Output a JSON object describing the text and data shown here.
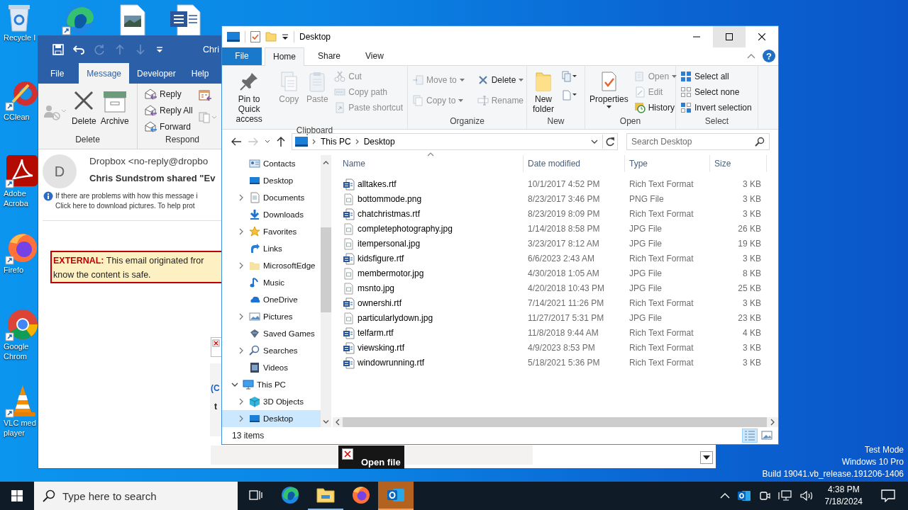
{
  "desktop": {
    "icons": [
      {
        "kind": "recycle",
        "label_lines": [
          "Recycle I"
        ]
      },
      {
        "kind": "ccleaner",
        "label_lines": [
          "CClean"
        ]
      },
      {
        "kind": "acrobat",
        "label_lines": [
          "Adobe",
          "Acroba"
        ]
      },
      {
        "kind": "firefox",
        "label_lines": [
          "Firefo"
        ]
      },
      {
        "kind": "chrome",
        "label_lines": [
          "Google",
          "Chrom"
        ]
      },
      {
        "kind": "vlc",
        "label_lines": [
          "VLC med",
          "player"
        ]
      }
    ],
    "top_icons": [
      {
        "kind": "edge"
      },
      {
        "kind": "image"
      },
      {
        "kind": "word"
      }
    ],
    "os_notice": [
      "Test Mode",
      "Windows 10 Pro",
      "Build 19041.vb_release.191206-1406"
    ]
  },
  "outlook": {
    "title": "Chri",
    "tabs": [
      {
        "label": "File",
        "selected": false
      },
      {
        "label": "Message",
        "selected": true
      },
      {
        "label": "Developer",
        "selected": false
      },
      {
        "label": "Help",
        "selected": false
      }
    ],
    "ribbon": {
      "delete_group": {
        "label": "Delete",
        "buttons": [
          "Delete",
          "Archive"
        ]
      },
      "respond_group": {
        "label": "Respond",
        "buttons": [
          "Reply",
          "Reply All",
          "Forward"
        ]
      }
    },
    "message": {
      "avatar": "D",
      "sender": "Dropbox <no-reply@dropbo",
      "subject": "Chris Sundstrom shared \"Ev",
      "info_lines": [
        "If there are problems with how this message i",
        "Click here to download pictures. To help prot"
      ],
      "banner_lines": [
        "**EXTERNAL:** This email originated fror",
        "know the content  is safe."
      ],
      "body_fragments": [
        "(C",
        "t"
      ],
      "file_button": "Open file"
    }
  },
  "explorer": {
    "title": "Desktop",
    "tabs": [
      {
        "label": "File",
        "kind": "file",
        "selected": false
      },
      {
        "label": "Home",
        "kind": "tab",
        "selected": true
      },
      {
        "label": "Share",
        "kind": "tab",
        "selected": false
      },
      {
        "label": "View",
        "kind": "tab",
        "selected": false
      }
    ],
    "help": "?",
    "ribbon": {
      "clipboard": {
        "label": "Clipboard",
        "large": [
          {
            "kind": "pin",
            "label": "Pin to Quick access",
            "disabled": false
          },
          {
            "kind": "copy",
            "label": "Copy",
            "disabled": true
          },
          {
            "kind": "paste",
            "label": "Paste",
            "disabled": true
          }
        ],
        "small": [
          {
            "kind": "cut",
            "label": "Cut",
            "disabled": true,
            "menu": false
          },
          {
            "kind": "copypath",
            "label": "Copy path",
            "disabled": true,
            "menu": false
          },
          {
            "kind": "pasteshortcut",
            "label": "Paste shortcut",
            "disabled": true,
            "menu": false
          }
        ]
      },
      "organize": {
        "label": "Organize",
        "columns": [
          [
            {
              "kind": "moveto",
              "label": "Move to",
              "disabled": true,
              "menu": true
            },
            {
              "kind": "copyto",
              "label": "Copy to",
              "disabled": true,
              "menu": true
            }
          ],
          [
            {
              "kind": "delete",
              "label": "Delete",
              "disabled": false,
              "menu": true
            },
            {
              "kind": "rename",
              "label": "Rename",
              "disabled": true,
              "menu": false
            }
          ]
        ]
      },
      "new": {
        "label": "New",
        "large": [
          {
            "kind": "newfolder",
            "label": "New folder",
            "disabled": false
          }
        ],
        "small": [
          {
            "kind": "newitem"
          },
          {
            "kind": "easyaccess"
          }
        ]
      },
      "open": {
        "label": "Open",
        "large": [
          {
            "kind": "properties",
            "label": "Properties",
            "disabled": false
          }
        ],
        "small": [
          {
            "kind": "open",
            "label": "Open",
            "disabled": true,
            "menu": true
          },
          {
            "kind": "edit",
            "label": "Edit",
            "disabled": true,
            "menu": false
          },
          {
            "kind": "history",
            "label": "History",
            "disabled": false,
            "menu": false
          }
        ]
      },
      "select": {
        "label": "Select",
        "small": [
          {
            "kind": "selectall",
            "label": "Select all",
            "disabled": false,
            "menu": false
          },
          {
            "kind": "selectnone",
            "label": "Select none",
            "disabled": false,
            "menu": false
          },
          {
            "kind": "invert",
            "label": "Invert selection",
            "disabled": false,
            "menu": false
          }
        ]
      }
    },
    "address": {
      "crumbs": [
        "This PC",
        "Desktop"
      ],
      "search_placeholder": "Search Desktop"
    },
    "nav": {
      "user_folders": [
        {
          "label": "Contacts",
          "kind": "contacts",
          "has_children": false,
          "expanded": false,
          "selected": false
        },
        {
          "label": "Desktop",
          "kind": "desktop",
          "has_children": false,
          "expanded": false,
          "selected": false
        },
        {
          "label": "Documents",
          "kind": "documents",
          "has_children": true,
          "expanded": false,
          "selected": false
        },
        {
          "label": "Downloads",
          "kind": "downloads",
          "has_children": false,
          "expanded": false,
          "selected": false
        },
        {
          "label": "Favorites",
          "kind": "star",
          "has_children": true,
          "expanded": false,
          "selected": false
        },
        {
          "label": "Links",
          "kind": "links",
          "has_children": false,
          "expanded": false,
          "selected": false
        },
        {
          "label": "MicrosoftEdge",
          "kind": "folder",
          "has_children": true,
          "expanded": false,
          "selected": false
        },
        {
          "label": "Music",
          "kind": "music",
          "has_children": false,
          "expanded": false,
          "selected": false
        },
        {
          "label": "OneDrive",
          "kind": "cloud",
          "has_children": false,
          "expanded": false,
          "selected": false
        },
        {
          "label": "Pictures",
          "kind": "pictures",
          "has_children": true,
          "expanded": false,
          "selected": false
        },
        {
          "label": "Saved Games",
          "kind": "games",
          "has_children": false,
          "expanded": false,
          "selected": false
        },
        {
          "label": "Searches",
          "kind": "search",
          "has_children": true,
          "expanded": false,
          "selected": false
        },
        {
          "label": "Videos",
          "kind": "videos",
          "has_children": false,
          "expanded": false,
          "selected": false
        }
      ],
      "this_pc": {
        "label": "This PC",
        "kind": "pc",
        "has_children": true,
        "expanded": true,
        "selected": false,
        "children": [
          {
            "label": "3D Objects",
            "kind": "cube",
            "has_children": true,
            "expanded": false,
            "selected": false
          },
          {
            "label": "Desktop",
            "kind": "desktop",
            "has_children": true,
            "expanded": false,
            "selected": true
          }
        ]
      }
    },
    "columns": [
      {
        "label": "Name",
        "sorted": true
      },
      {
        "label": "Date modified",
        "sorted": false
      },
      {
        "label": "Type",
        "sorted": false
      },
      {
        "label": "Size",
        "sorted": false
      }
    ],
    "files": [
      {
        "kind": "rtf",
        "name": "alltakes.rtf",
        "date": "10/1/2017 4:52 PM",
        "type": "Rich Text Format",
        "size": "3 KB"
      },
      {
        "kind": "image",
        "name": "bottommode.png",
        "date": "8/23/2017 3:46 PM",
        "type": "PNG File",
        "size": "3 KB"
      },
      {
        "kind": "rtf",
        "name": "chatchristmas.rtf",
        "date": "8/23/2019 8:09 PM",
        "type": "Rich Text Format",
        "size": "3 KB"
      },
      {
        "kind": "image",
        "name": "completephotography.jpg",
        "date": "1/14/2018 8:58 PM",
        "type": "JPG File",
        "size": "26 KB"
      },
      {
        "kind": "image",
        "name": "itempersonal.jpg",
        "date": "3/23/2017 8:12 AM",
        "type": "JPG File",
        "size": "19 KB"
      },
      {
        "kind": "rtf",
        "name": "kidsfigure.rtf",
        "date": "6/6/2023 2:43 AM",
        "type": "Rich Text Format",
        "size": "3 KB"
      },
      {
        "kind": "image",
        "name": "membermotor.jpg",
        "date": "4/30/2018 1:05 AM",
        "type": "JPG File",
        "size": "8 KB"
      },
      {
        "kind": "image",
        "name": "msnto.jpg",
        "date": "4/20/2018 10:43 PM",
        "type": "JPG File",
        "size": "25 KB"
      },
      {
        "kind": "rtf",
        "name": "ownershi.rtf",
        "date": "7/14/2021 11:26 PM",
        "type": "Rich Text Format",
        "size": "3 KB"
      },
      {
        "kind": "image",
        "name": "particularlydown.jpg",
        "date": "11/27/2017 5:31 PM",
        "type": "JPG File",
        "size": "23 KB"
      },
      {
        "kind": "rtf",
        "name": "telfarm.rtf",
        "date": "11/8/2018 9:44 AM",
        "type": "Rich Text Format",
        "size": "4 KB"
      },
      {
        "kind": "rtf",
        "name": "viewsking.rtf",
        "date": "4/9/2023 8:53 PM",
        "type": "Rich Text Format",
        "size": "3 KB"
      },
      {
        "kind": "rtf",
        "name": "windowrunning.rtf",
        "date": "5/18/2021 5:36 PM",
        "type": "Rich Text Format",
        "size": "3 KB"
      }
    ],
    "status": "13 items",
    "views": [
      {
        "kind": "details",
        "selected": true
      },
      {
        "kind": "large",
        "selected": false
      }
    ]
  },
  "taskbar": {
    "search_placeholder": "Type here to search",
    "apps": [
      {
        "kind": "taskview",
        "running": false,
        "active": false
      },
      {
        "kind": "edge",
        "running": false,
        "active": false
      },
      {
        "kind": "explorer",
        "running": true,
        "active": false
      },
      {
        "kind": "firefox",
        "running": false,
        "active": false
      },
      {
        "kind": "outlook",
        "running": true,
        "active": true
      }
    ],
    "tray": [
      {
        "kind": "caret"
      },
      {
        "kind": "outlook"
      },
      {
        "kind": "meet"
      },
      {
        "kind": "network"
      },
      {
        "kind": "volume"
      }
    ],
    "time": "4:38 PM",
    "date": "7/18/2024"
  }
}
